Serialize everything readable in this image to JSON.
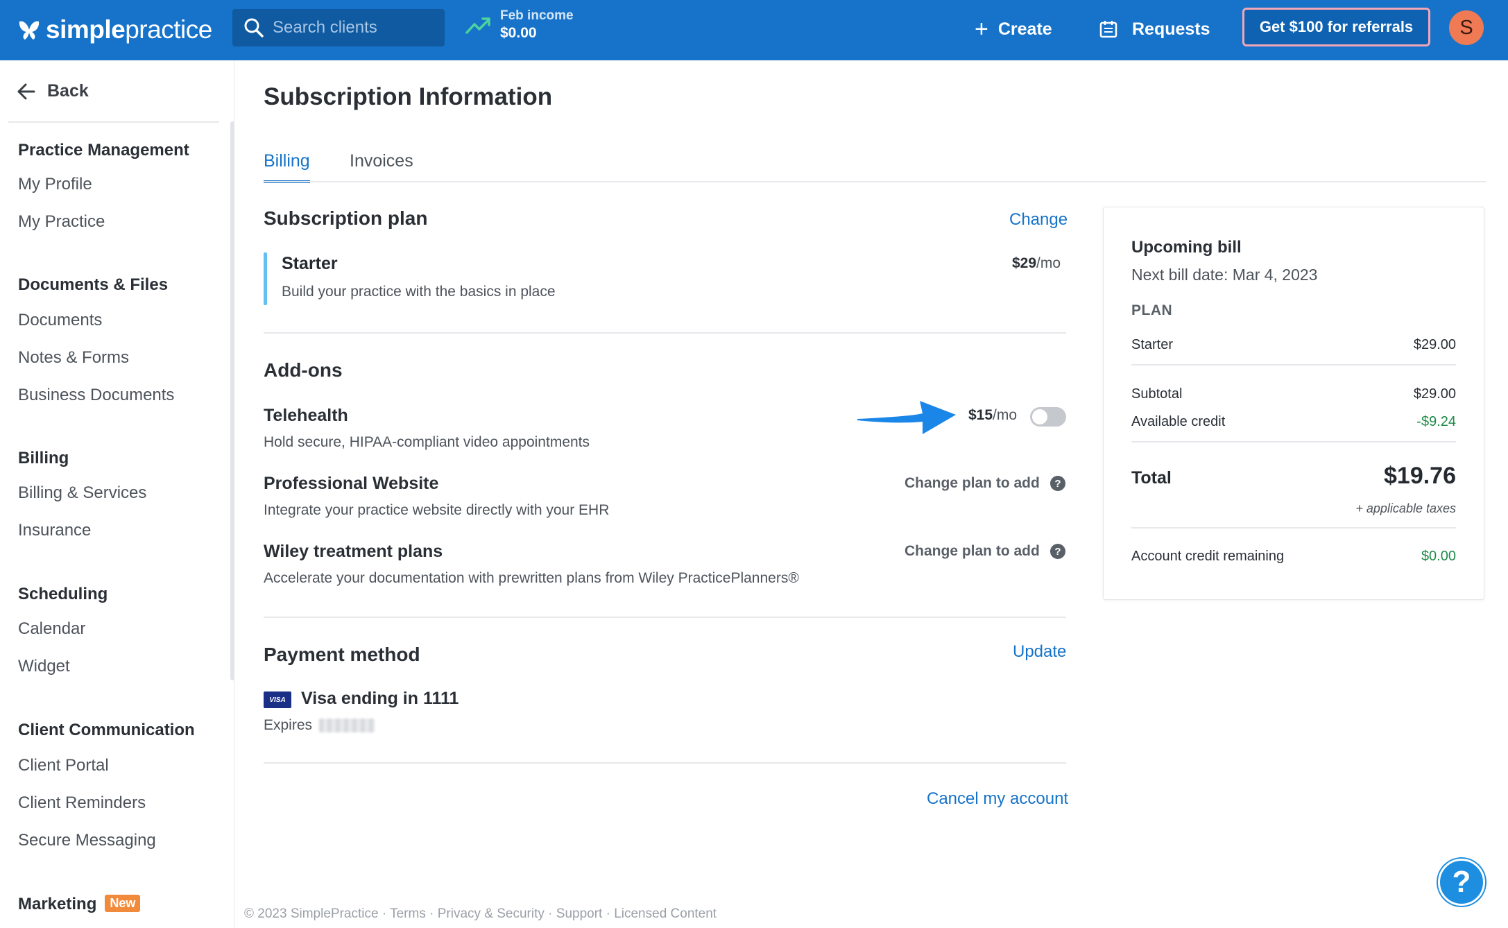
{
  "header": {
    "logo_bold": "simple",
    "logo_light": "practice",
    "search_placeholder": "Search clients",
    "income_label": "Feb income",
    "income_value": "$0.00",
    "create_label": "Create",
    "requests_label": "Requests",
    "referral_label": "Get $100 for referrals",
    "avatar_initial": "S"
  },
  "sidebar": {
    "back_label": "Back",
    "sections": [
      {
        "title": "Practice Management",
        "items": [
          "My Profile",
          "My Practice"
        ]
      },
      {
        "title": "Documents & Files",
        "items": [
          "Documents",
          "Notes & Forms",
          "Business Documents"
        ]
      },
      {
        "title": "Billing",
        "items": [
          "Billing & Services",
          "Insurance"
        ]
      },
      {
        "title": "Scheduling",
        "items": [
          "Calendar",
          "Widget"
        ]
      },
      {
        "title": "Client Communication",
        "items": [
          "Client Portal",
          "Client Reminders",
          "Secure Messaging"
        ]
      },
      {
        "title": "Marketing",
        "badge": "New"
      }
    ]
  },
  "main": {
    "title": "Subscription Information",
    "tabs": [
      {
        "label": "Billing",
        "active": true
      },
      {
        "label": "Invoices",
        "active": false
      }
    ],
    "subscription": {
      "heading": "Subscription plan",
      "change_label": "Change",
      "plan_name": "Starter",
      "plan_desc": "Build your practice with the basics in place",
      "price": "$29",
      "per": "/mo"
    },
    "addons": {
      "heading": "Add-ons",
      "items": [
        {
          "name": "Telehealth",
          "desc": "Hold secure, HIPAA-compliant video appointments",
          "price": "$15",
          "per": "/mo",
          "enabled": false
        },
        {
          "name": "Professional Website",
          "desc": "Integrate your practice website directly with your EHR",
          "action": "Change plan to add"
        },
        {
          "name": "Wiley treatment plans",
          "desc": "Accelerate your documentation with prewritten plans from Wiley PracticePlanners®",
          "action": "Change plan to add"
        }
      ]
    },
    "payment": {
      "heading": "Payment method",
      "update_label": "Update",
      "card_brand": "VISA",
      "card_text": "Visa ending in 1111",
      "expires_label": "Expires"
    },
    "cancel_label": "Cancel my account"
  },
  "bill": {
    "title": "Upcoming bill",
    "next_date": "Next bill date: Mar 4, 2023",
    "plan_label": "PLAN",
    "plan_name": "Starter",
    "plan_amount": "$29.00",
    "subtotal_label": "Subtotal",
    "subtotal": "$29.00",
    "credit_label": "Available credit",
    "credit": "-$9.24",
    "total_label": "Total",
    "total": "$19.76",
    "taxes": "+ applicable taxes",
    "remaining_label": "Account credit remaining",
    "remaining": "$0.00"
  },
  "footer": {
    "copyright": "© 2023 SimplePractice",
    "links": [
      "Terms",
      "Privacy & Security",
      "Support",
      "Licensed Content"
    ]
  },
  "help_fab": "?",
  "colors": {
    "brand_blue": "#1673c9",
    "accent_green": "#1f8a4a",
    "badge_orange": "#f28a3c",
    "avatar": "#f07a54"
  },
  "icons": [
    "logo-butterfly-icon",
    "search-icon",
    "trend-up-icon",
    "plus-icon",
    "calendar-icon",
    "arrow-left-icon",
    "question-icon",
    "blue-arrow-icon"
  ]
}
